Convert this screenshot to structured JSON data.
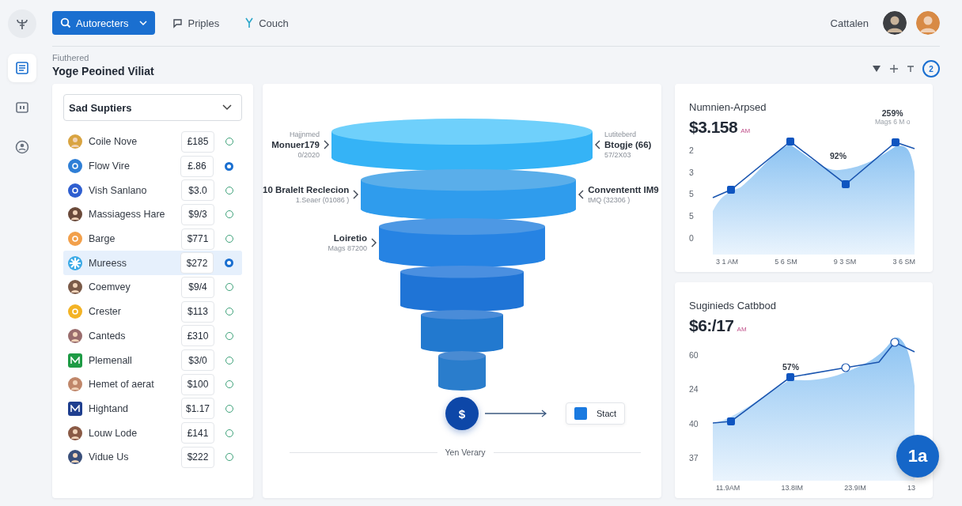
{
  "rail_items": [
    {
      "selected": true
    },
    {
      "selected": false
    },
    {
      "selected": false
    }
  ],
  "top_nav": [
    {
      "label": "Autorecters",
      "kind": "dropdown",
      "selected": true
    },
    {
      "label": "Priples",
      "kind": "comment",
      "selected": false
    },
    {
      "label": "Couch",
      "kind": "pin",
      "selected": false
    }
  ],
  "user": {
    "name": "Cattalen"
  },
  "header": {
    "eyebrow": "Fiuthered",
    "title": "Yoge Peoined Viliat",
    "badge": "2"
  },
  "suppliers": {
    "dropdown": "Sad Suptiers",
    "items": [
      {
        "name": "Coile Nove",
        "amount": "£185",
        "color": "#d9a441",
        "kind": "person",
        "selected": false,
        "checked": false
      },
      {
        "name": "Flow Vire",
        "amount": "£.86",
        "color": "#2f7fd6",
        "kind": "logo",
        "selected": false,
        "checked": true
      },
      {
        "name": "Vish Sanlano",
        "amount": "$3.0",
        "color": "#2f5fd0",
        "kind": "logo",
        "selected": false,
        "checked": false
      },
      {
        "name": "Massiagess Hare",
        "amount": "$9/3",
        "color": "#6b4a3a",
        "kind": "person",
        "selected": false,
        "checked": false
      },
      {
        "name": "Barge",
        "amount": "$771",
        "color": "#f2a04b",
        "kind": "logo",
        "selected": false,
        "checked": false
      },
      {
        "name": "Mureess",
        "amount": "$272",
        "color": "#39a9e6",
        "kind": "star",
        "selected": true,
        "checked": true
      },
      {
        "name": "Coemvey",
        "amount": "$9/4",
        "color": "#7a5a48",
        "kind": "person",
        "selected": false,
        "checked": false
      },
      {
        "name": "Crester",
        "amount": "$113",
        "color": "#f3b325",
        "kind": "logo",
        "selected": false,
        "checked": false
      },
      {
        "name": "Canteds",
        "amount": "£310",
        "color": "#9a6d6d",
        "kind": "person",
        "selected": false,
        "checked": false
      },
      {
        "name": "Plemenall",
        "amount": "$3/0",
        "color": "#1e9b45",
        "kind": "square",
        "selected": false,
        "checked": false
      },
      {
        "name": "Hemet of aerat",
        "amount": "$100",
        "color": "#c0876a",
        "kind": "person",
        "selected": false,
        "checked": false
      },
      {
        "name": "Hightand",
        "amount": "$1.17",
        "color": "#1f3f8f",
        "kind": "square",
        "selected": false,
        "checked": false
      },
      {
        "name": "Louw Lode",
        "amount": "£141",
        "color": "#8a5a45",
        "kind": "person",
        "selected": false,
        "checked": false
      },
      {
        "name": "Vidue Us",
        "amount": "$222",
        "color": "#3a4f7a",
        "kind": "person",
        "selected": false,
        "checked": false
      }
    ]
  },
  "funnel": {
    "stages": [
      {
        "kind": "disc",
        "left": {
          "caption": "Hajjnmed",
          "title": "Monuer179",
          "sub": "0/2020"
        },
        "right": {
          "caption": "Lutiteberd",
          "title": "Btogje (66)",
          "sub": "57/2X03"
        }
      },
      {
        "kind": "disc",
        "left": {
          "title": "10 Bralelt Reclecion",
          "sub": "1.Seaer (01086 )"
        },
        "right": {
          "title": "Convententt IM9",
          "sub": "tMQ (32306 )"
        }
      },
      {
        "kind": "disc",
        "left": {
          "title": "Loiretio",
          "sub": "Mags 87200"
        }
      },
      {
        "kind": "disc"
      },
      {
        "kind": "disc"
      },
      {
        "kind": "disc"
      }
    ],
    "end_symbol": "$",
    "legend": "Stact",
    "footer": "Yen Verary"
  },
  "cards": [
    {
      "kind": "wave",
      "title": "Numnien-Arpsed",
      "value": "$3.158",
      "unit": "AM",
      "yticks": [
        "2",
        "3",
        "5",
        "5",
        "0"
      ],
      "xticks": [
        "3 1 AM",
        "5 6 SM",
        "9 3 SM",
        "3 6 SM"
      ],
      "point_labels": [
        {
          "text": "259%",
          "sub": "Mags 6 M o"
        },
        {
          "text": "92%"
        }
      ]
    },
    {
      "kind": "rise",
      "title": "Suginieds Catbbod",
      "value": "$6:/17",
      "unit": "AM",
      "yticks": [
        "60",
        "24",
        "40",
        "37"
      ],
      "xticks": [
        "11.9AM",
        "13.8IM",
        "23.9IM",
        "13"
      ],
      "point_labels": [
        {
          "text": "57%"
        }
      ]
    }
  ],
  "fab": "1a"
}
